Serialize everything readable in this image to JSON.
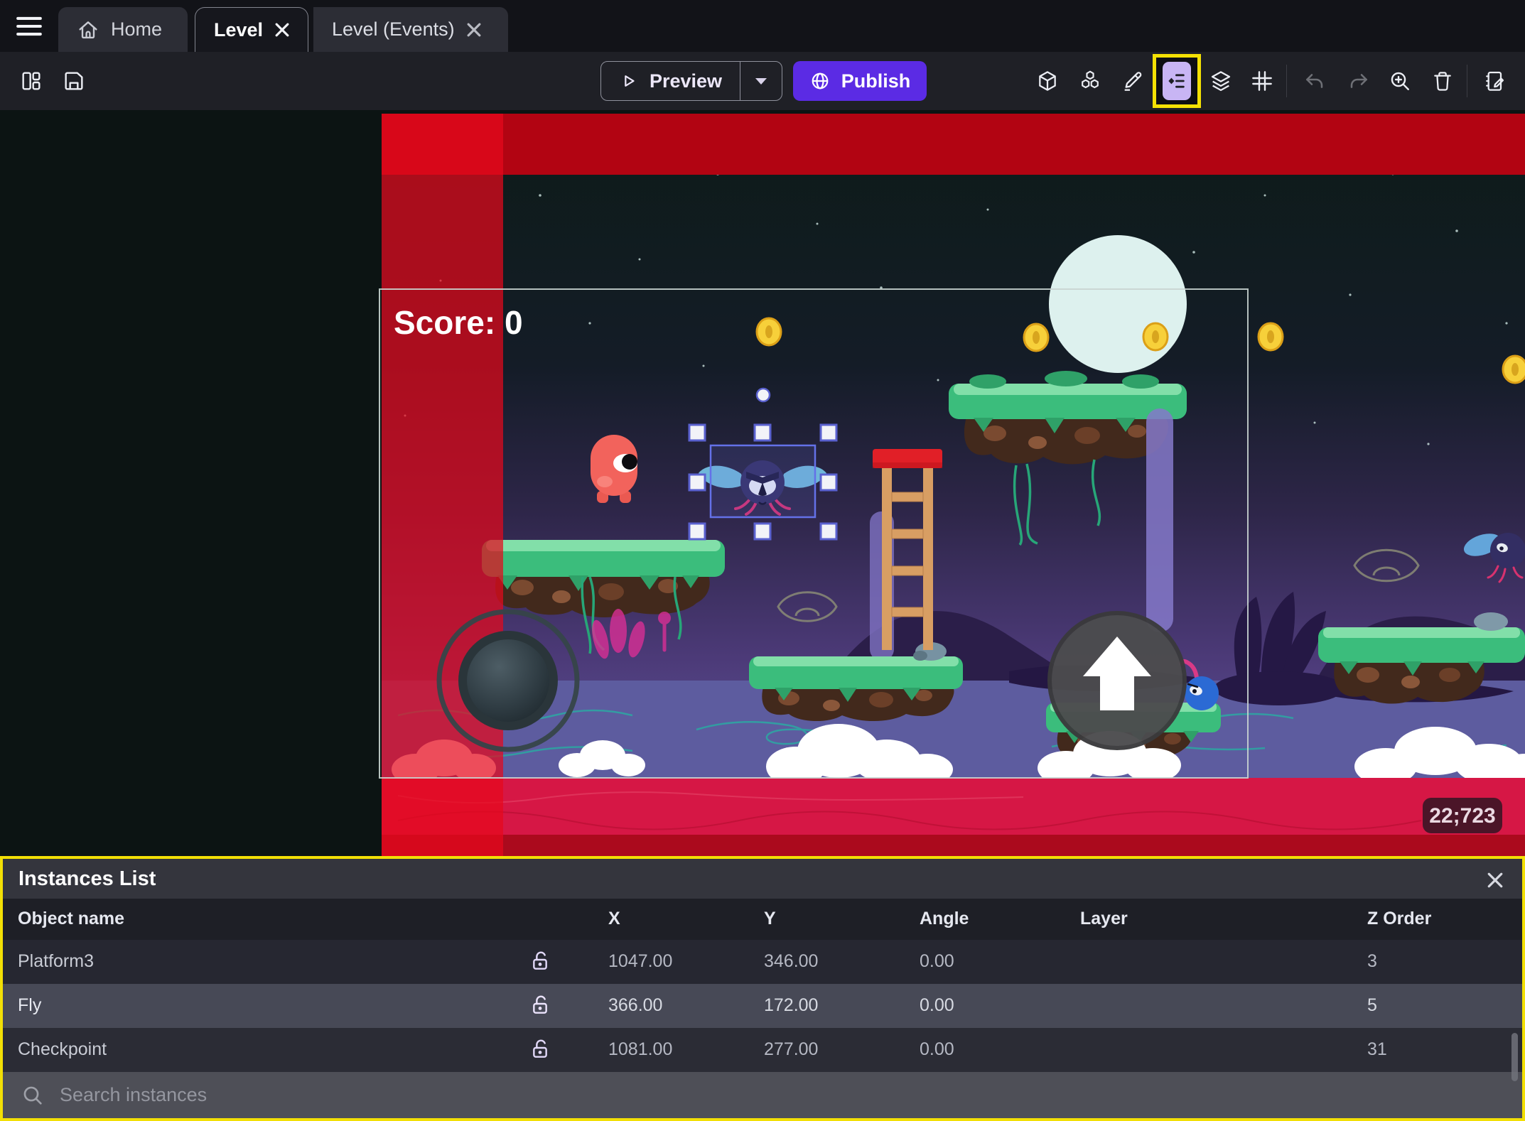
{
  "tabs": {
    "home_label": "Home",
    "level_label": "Level",
    "level_events_label": "Level (Events)"
  },
  "toolbar": {
    "preview_label": "Preview",
    "publish_label": "Publish"
  },
  "canvas": {
    "score_label": "Score: 0",
    "coordinates_badge": "22;723"
  },
  "instances_panel": {
    "title": "Instances List",
    "columns": {
      "object_name": "Object name",
      "x": "X",
      "y": "Y",
      "angle": "Angle",
      "layer": "Layer",
      "z_order": "Z Order"
    },
    "rows": [
      {
        "name": "Platform3",
        "x": "1047.00",
        "y": "346.00",
        "angle": "0.00",
        "layer": "",
        "z_order": "3"
      },
      {
        "name": "Fly",
        "x": "366.00",
        "y": "172.00",
        "angle": "0.00",
        "layer": "",
        "z_order": "5"
      },
      {
        "name": "Checkpoint",
        "x": "1081.00",
        "y": "277.00",
        "angle": "0.00",
        "layer": "",
        "z_order": "31"
      }
    ],
    "search_placeholder": "Search instances"
  },
  "icons": {
    "menu": "hamburger-menu-icon",
    "home": "home-icon",
    "close_tab": "close-icon",
    "layout": "layout-panels-icon",
    "save": "save-icon",
    "play": "play-icon",
    "dropdown": "chevron-down-icon",
    "globe": "globe-icon",
    "cube": "object-3d-icon",
    "objects": "objects-stack-icon",
    "pencil": "edit-pencil-icon",
    "instances_list": "instances-list-icon",
    "layers": "layers-icon",
    "grid": "grid-icon",
    "undo": "undo-icon",
    "redo": "redo-icon",
    "zoom_in": "zoom-in-icon",
    "trash": "trash-icon",
    "properties": "notebook-edit-icon",
    "lock_open": "lock-open-icon",
    "search": "search-icon"
  },
  "colors": {
    "accent_purple": "#5b2be4",
    "highlight_yellow": "#f2df05",
    "selected_row": "#474956",
    "scene_red_overlay": "#e6081c",
    "selection_blue": "#5a61cf"
  }
}
